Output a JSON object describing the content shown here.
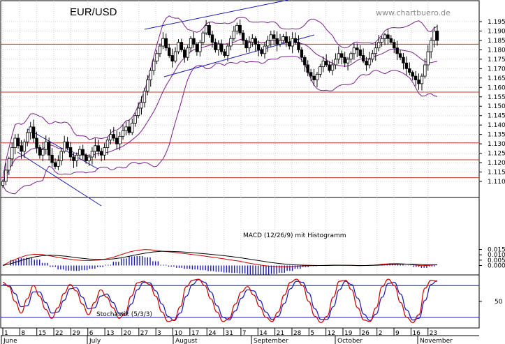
{
  "chart_data": [
    {
      "type": "candlestick",
      "title": "EUR/USD",
      "source": "www.chartbuero.de",
      "y_ticks": [
        "1.195",
        "1.190",
        "1.185",
        "1.180",
        "1.175",
        "1.170",
        "1.165",
        "1.160",
        "1.155",
        "1.150",
        "1.145",
        "1.140",
        "1.135",
        "1.130",
        "1.125",
        "1.120",
        "1.115",
        "1.110"
      ],
      "ylim": [
        1.108,
        1.2
      ],
      "x_day_ticks": [
        "1",
        "8",
        "15",
        "22",
        "29",
        "6",
        "13",
        "20",
        "27",
        "3",
        "10",
        "17",
        "24",
        "31",
        "7",
        "14",
        "21",
        "28",
        "5",
        "12",
        "19",
        "26",
        "2",
        "9",
        "16",
        "23"
      ],
      "x_month_labels": [
        "June",
        "July",
        "August",
        "September",
        "October",
        "November"
      ],
      "horizontal_levels": [
        1.183,
        1.1575,
        1.1305,
        1.1215,
        1.112
      ],
      "series": [
        {
          "name": "price",
          "values": [
            1.11,
            1.116,
            1.122,
            1.128,
            1.133,
            1.129,
            1.126,
            1.131,
            1.136,
            1.139,
            1.133,
            1.128,
            1.124,
            1.127,
            1.131,
            1.124,
            1.12,
            1.118,
            1.121,
            1.126,
            1.131,
            1.128,
            1.123,
            1.121,
            1.124,
            1.127,
            1.124,
            1.121,
            1.123,
            1.126,
            1.129,
            1.126,
            1.124,
            1.128,
            1.132,
            1.135,
            1.133,
            1.13,
            1.134,
            1.137,
            1.139,
            1.136,
            1.141,
            1.145,
            1.149,
            1.152,
            1.158,
            1.164,
            1.169,
            1.174,
            1.178,
            1.182,
            1.186,
            1.181,
            1.177,
            1.174,
            1.179,
            1.184,
            1.18,
            1.176,
            1.181,
            1.186,
            1.183,
            1.179,
            1.184,
            1.189,
            1.193,
            1.188,
            1.184,
            1.18,
            1.183,
            1.179,
            1.177,
            1.182,
            1.186,
            1.19,
            1.193,
            1.189,
            1.185,
            1.181,
            1.184,
            1.186,
            1.183,
            1.18,
            1.178,
            1.182,
            1.185,
            1.188,
            1.186,
            1.183,
            1.185,
            1.187,
            1.184,
            1.182,
            1.186,
            1.184,
            1.18,
            1.176,
            1.172,
            1.168,
            1.166,
            1.164,
            1.167,
            1.171,
            1.174,
            1.172,
            1.169,
            1.172,
            1.175,
            1.178,
            1.176,
            1.173,
            1.175,
            1.178,
            1.181,
            1.18,
            1.177,
            1.174,
            1.172,
            1.175,
            1.178,
            1.181,
            1.184,
            1.186,
            1.188,
            1.186,
            1.184,
            1.181,
            1.178,
            1.176,
            1.173,
            1.17,
            1.168,
            1.166,
            1.164,
            1.162,
            1.166,
            1.172,
            1.179,
            1.185,
            1.19,
            1.185
          ]
        }
      ]
    },
    {
      "type": "line",
      "title": "MACD (12/26/9) mit Histogramm",
      "y_ticks": [
        "0.015",
        "0.010",
        "0.005",
        "0.000"
      ],
      "ylim": [
        -0.0025,
        0.0175
      ],
      "series": [
        {
          "name": "MACD",
          "values": [
            0.0,
            0.004,
            0.007,
            0.0095,
            0.0105,
            0.0103,
            0.009,
            0.0076,
            0.0064,
            0.0054,
            0.0048,
            0.0046,
            0.005,
            0.006,
            0.0078,
            0.0102,
            0.0126,
            0.0142,
            0.015,
            0.0145,
            0.0136,
            0.0128,
            0.012,
            0.0112,
            0.0103,
            0.0094,
            0.0083,
            0.0073,
            0.0062,
            0.0051,
            0.004,
            0.0024,
            0.0011,
            0.0,
            -0.0008,
            -0.0012,
            -0.0012,
            -0.0008,
            -0.0004,
            -0.0002,
            0.0,
            0.0002,
            0.0004,
            0.0003,
            0.0001,
            -0.0001,
            0.0,
            0.0004,
            0.0011,
            0.0017,
            0.0018,
            0.0014,
            0.0006,
            -0.0002,
            0.0002,
            0.0008
          ]
        },
        {
          "name": "Signal",
          "values": [
            0.0,
            0.0017,
            0.0039,
            0.0062,
            0.008,
            0.0092,
            0.0096,
            0.0093,
            0.0086,
            0.0077,
            0.0068,
            0.006,
            0.0057,
            0.0057,
            0.0062,
            0.0072,
            0.0087,
            0.0102,
            0.0115,
            0.0127,
            0.0133,
            0.0133,
            0.013,
            0.0126,
            0.012,
            0.0114,
            0.0107,
            0.01,
            0.0092,
            0.0083,
            0.0074,
            0.0062,
            0.0051,
            0.0039,
            0.0028,
            0.0019,
            0.0011,
            0.0006,
            0.0003,
            0.0001,
            0.0,
            0.0,
            0.0001,
            0.0001,
            0.0001,
            0.0,
            0.0,
            0.0001,
            0.0004,
            0.0008,
            0.0011,
            0.0013,
            0.0012,
            0.0008,
            0.0006,
            0.0006
          ]
        }
      ]
    },
    {
      "type": "line",
      "title": "Stochastik (5/3/3)",
      "y_ticks": [
        "50"
      ],
      "ylim": [
        0,
        100
      ],
      "reference_levels": [
        80,
        20
      ],
      "series": [
        {
          "name": "%K",
          "values": [
            86,
            78,
            50,
            28,
            55,
            80,
            60,
            35,
            18,
            38,
            65,
            82,
            70,
            45,
            25,
            48,
            72,
            58,
            38,
            18,
            28,
            60,
            85,
            88,
            82,
            60,
            30,
            12,
            15,
            40,
            78,
            90,
            92,
            80,
            55,
            30,
            12,
            18,
            45,
            68,
            78,
            62,
            40,
            20,
            12,
            30,
            62,
            86,
            92,
            80,
            50,
            22,
            10,
            22,
            58,
            88,
            90,
            72,
            38,
            15,
            12,
            38,
            78,
            92,
            80,
            48,
            20,
            10,
            25,
            75,
            90,
            88
          ]
        },
        {
          "name": "%D",
          "values": [
            82,
            80,
            65,
            40,
            42,
            68,
            68,
            48,
            28,
            30,
            52,
            74,
            76,
            58,
            36,
            38,
            60,
            64,
            48,
            28,
            24,
            45,
            72,
            86,
            85,
            70,
            45,
            22,
            14,
            28,
            60,
            82,
            91,
            86,
            68,
            42,
            20,
            15,
            32,
            56,
            72,
            70,
            52,
            30,
            16,
            22,
            46,
            74,
            88,
            86,
            66,
            36,
            16,
            16,
            40,
            72,
            88,
            82,
            56,
            26,
            14,
            26,
            58,
            84,
            86,
            64,
            34,
            15,
            18,
            52,
            82,
            89
          ]
        }
      ]
    }
  ]
}
